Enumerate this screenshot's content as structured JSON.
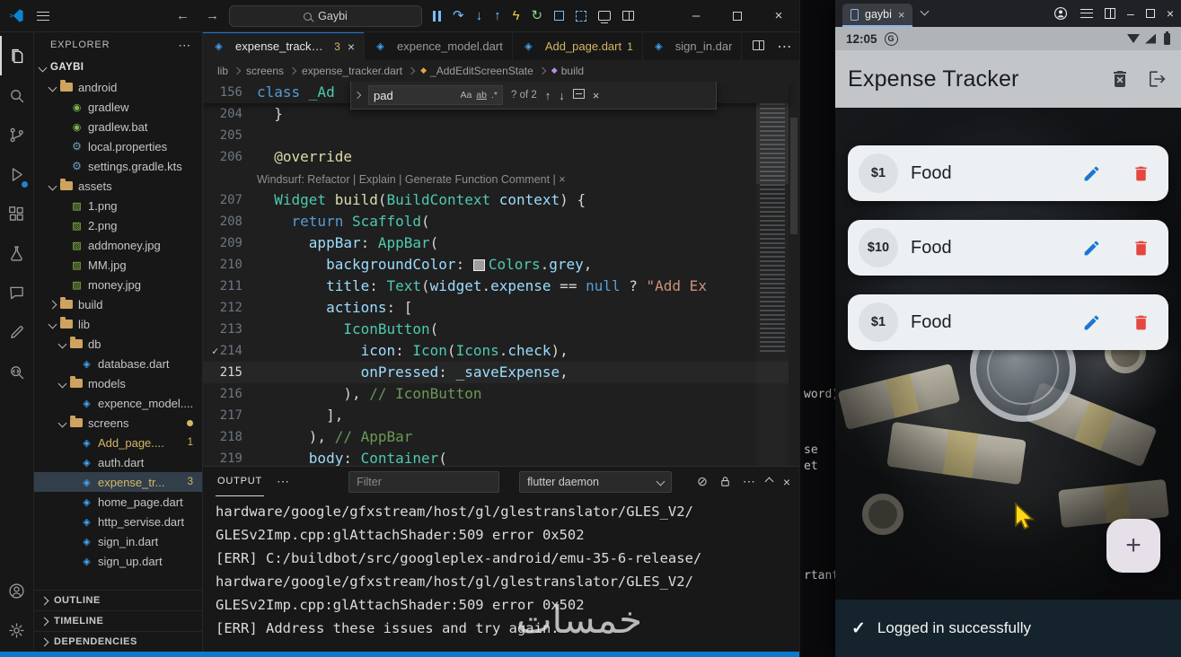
{
  "watermark": "خمسات",
  "fragments": [
    "word)",
    "se",
    "et",
    "rtant"
  ],
  "glyphs": {
    "close": "×",
    "more": "⋯",
    "minimize": "–",
    "check": "✓",
    "plus": "+",
    "back": "←",
    "forward": "→",
    "step_over": "↷",
    "arrow_down": "↓",
    "arrow_up": "↑",
    "bolt": "ϟ",
    "restart": "↻",
    "clear": "⊘",
    "dart": "◈",
    "image": "▨",
    "gradle": "◉",
    "gear": "⚙",
    "sym": "◆"
  },
  "vscode": {
    "titlebar": {
      "search": "Gaybi"
    },
    "activity_bar": [
      "explorer",
      "search",
      "source-control",
      "run-debug",
      "extensions",
      "testing",
      "chat",
      "edit",
      "code-search"
    ],
    "activity_bar_bottom": [
      "account",
      "settings"
    ],
    "explorer": {
      "title": "EXPLORER",
      "sections": [
        "OUTLINE",
        "TIMELINE",
        "DEPENDENCIES"
      ],
      "rows": [
        {
          "label": "GAYBI",
          "type": "root",
          "state": "expanded",
          "depth": 0
        },
        {
          "label": "android",
          "type": "folder",
          "state": "expanded",
          "depth": 1
        },
        {
          "label": "gradlew",
          "type": "file",
          "icon": "gradle",
          "depth": 2
        },
        {
          "label": "gradlew.bat",
          "type": "file",
          "icon": "gradle",
          "depth": 2
        },
        {
          "label": "local.properties",
          "type": "file",
          "icon": "gear",
          "depth": 2
        },
        {
          "label": "settings.gradle.kts",
          "type": "file",
          "icon": "gear",
          "depth": 2
        },
        {
          "label": "assets",
          "type": "folder",
          "state": "expanded",
          "depth": 1
        },
        {
          "label": "1.png",
          "type": "file",
          "icon": "image",
          "depth": 2
        },
        {
          "label": "2.png",
          "type": "file",
          "icon": "image",
          "depth": 2
        },
        {
          "label": "addmoney.jpg",
          "type": "file",
          "icon": "image",
          "depth": 2
        },
        {
          "label": "MM.jpg",
          "type": "file",
          "icon": "image",
          "depth": 2
        },
        {
          "label": "money.jpg",
          "type": "file",
          "icon": "image",
          "depth": 2
        },
        {
          "label": "build",
          "type": "folder",
          "state": "collapsed",
          "depth": 1
        },
        {
          "label": "lib",
          "type": "folder",
          "state": "expanded",
          "depth": 1
        },
        {
          "label": "db",
          "type": "folder",
          "state": "expanded",
          "depth": 2
        },
        {
          "label": "database.dart",
          "type": "file",
          "icon": "dart",
          "depth": 3
        },
        {
          "label": "models",
          "type": "folder",
          "state": "expanded",
          "depth": 2
        },
        {
          "label": "expence_model....",
          "type": "file",
          "icon": "dart",
          "depth": 3
        },
        {
          "label": "screens",
          "type": "folder",
          "state": "expanded",
          "depth": 2,
          "badge": "dot"
        },
        {
          "label": "Add_page....",
          "type": "file",
          "icon": "dart",
          "depth": 3,
          "badge": "1",
          "warn": true
        },
        {
          "label": "auth.dart",
          "type": "file",
          "icon": "dart",
          "depth": 3
        },
        {
          "label": "expense_tr...",
          "type": "file",
          "icon": "dart",
          "depth": 3,
          "badge": "3",
          "warn": true,
          "selected": true
        },
        {
          "label": "home_page.dart",
          "type": "file",
          "icon": "dart",
          "depth": 3
        },
        {
          "label": "http_servise.dart",
          "type": "file",
          "icon": "dart",
          "depth": 3
        },
        {
          "label": "sign_in.dart",
          "type": "file",
          "icon": "dart",
          "depth": 3
        },
        {
          "label": "sign_up.dart",
          "type": "file",
          "icon": "dart",
          "depth": 3
        }
      ]
    },
    "tabs": [
      {
        "label": "expense_tracker.dart",
        "badge": "3",
        "active": true
      },
      {
        "label": "expence_model.dart"
      },
      {
        "label": "Add_page.dart",
        "badge": "1",
        "warn": true
      },
      {
        "label": "sign_in.dar"
      }
    ],
    "breadcrumb": [
      {
        "label": "lib"
      },
      {
        "label": "screens"
      },
      {
        "label": "expense_tracker.dart"
      },
      {
        "label": "_AddEditScreenState",
        "sym": "class"
      },
      {
        "label": "build",
        "sym": "method"
      }
    ],
    "find": {
      "value": "pad",
      "results": "? of 2",
      "toggles": [
        "Aa",
        "ab",
        ".*"
      ]
    },
    "editor": {
      "current_line": "215",
      "check_line": "214",
      "codelens": "Windsurf: Refactor | Explain | Generate Function Comment | ×",
      "lines": [
        {
          "n": "156",
          "sticky": true,
          "t": [
            [
              "kw",
              "class "
            ],
            [
              "type",
              "_Ad"
            ]
          ]
        },
        {
          "n": "204",
          "t": [
            [
              "pun",
              "  }"
            ]
          ]
        },
        {
          "n": "205",
          "t": []
        },
        {
          "n": "206",
          "t": [
            [
              "meta",
              "  @override"
            ]
          ]
        },
        {
          "lens": true
        },
        {
          "n": "207",
          "t": [
            [
              "type",
              "  Widget "
            ],
            [
              "fn",
              "build"
            ],
            [
              "pun",
              "("
            ],
            [
              "type",
              "BuildContext"
            ],
            [
              "var",
              " context"
            ],
            [
              "pun",
              ") {"
            ]
          ]
        },
        {
          "n": "208",
          "t": [
            [
              "pun",
              "    "
            ],
            [
              "kw",
              "return"
            ],
            [
              "type",
              " Scaffold"
            ],
            [
              "pun",
              "("
            ]
          ]
        },
        {
          "n": "209",
          "t": [
            [
              "pun",
              "      "
            ],
            [
              "prop",
              "appBar"
            ],
            [
              "pun",
              ": "
            ],
            [
              "type",
              "AppBar"
            ],
            [
              "pun",
              "("
            ]
          ]
        },
        {
          "n": "210",
          "t": [
            [
              "pun",
              "        "
            ],
            [
              "prop",
              "backgroundColor"
            ],
            [
              "pun",
              ": "
            ],
            [
              "swatch",
              ""
            ],
            [
              "type",
              "Colors"
            ],
            [
              "pun",
              "."
            ],
            [
              "var",
              "grey"
            ],
            [
              "pun",
              ","
            ]
          ]
        },
        {
          "n": "211",
          "t": [
            [
              "pun",
              "        "
            ],
            [
              "prop",
              "title"
            ],
            [
              "pun",
              ": "
            ],
            [
              "type",
              "Text"
            ],
            [
              "pun",
              "("
            ],
            [
              "var",
              "widget"
            ],
            [
              "pun",
              "."
            ],
            [
              "var",
              "expense"
            ],
            [
              "op",
              " == "
            ],
            [
              "kw",
              "null"
            ],
            [
              "op",
              " ? "
            ],
            [
              "str",
              "\"Add Ex"
            ]
          ]
        },
        {
          "n": "212",
          "t": [
            [
              "pun",
              "        "
            ],
            [
              "prop",
              "actions"
            ],
            [
              "pun",
              ": ["
            ]
          ]
        },
        {
          "n": "213",
          "t": [
            [
              "pun",
              "          "
            ],
            [
              "type",
              "IconButton"
            ],
            [
              "pun",
              "("
            ]
          ]
        },
        {
          "n": "214",
          "t": [
            [
              "pun",
              "            "
            ],
            [
              "prop",
              "icon"
            ],
            [
              "pun",
              ": "
            ],
            [
              "type",
              "Icon"
            ],
            [
              "pun",
              "("
            ],
            [
              "type",
              "Icons"
            ],
            [
              "pun",
              "."
            ],
            [
              "var",
              "check"
            ],
            [
              "pun",
              "),"
            ]
          ]
        },
        {
          "n": "215",
          "t": [
            [
              "pun",
              "            "
            ],
            [
              "prop",
              "onPressed"
            ],
            [
              "pun",
              ": "
            ],
            [
              "var",
              "_saveExpense"
            ],
            [
              "pun",
              ","
            ]
          ]
        },
        {
          "n": "216",
          "t": [
            [
              "pun",
              "          ), "
            ],
            [
              "cmt",
              "// IconButton"
            ]
          ]
        },
        {
          "n": "217",
          "t": [
            [
              "pun",
              "        ],"
            ]
          ]
        },
        {
          "n": "218",
          "t": [
            [
              "pun",
              "      ), "
            ],
            [
              "cmt",
              "// AppBar"
            ]
          ]
        },
        {
          "n": "219",
          "t": [
            [
              "pun",
              "      "
            ],
            [
              "prop",
              "body"
            ],
            [
              "pun",
              ": "
            ],
            [
              "type",
              "Container"
            ],
            [
              "pun",
              "("
            ]
          ]
        }
      ]
    },
    "panel": {
      "tab": "OUTPUT",
      "filter_placeholder": "Filter",
      "channel": "flutter daemon",
      "lines": [
        "hardware/google/gfxstream/host/gl/glestranslator/GLES_V2/",
        "GLESv2Imp.cpp:glAttachShader:509 error 0x502",
        "[ERR] C:/buildbot/src/googleplex-android/emu-35-6-release/",
        "hardware/google/gfxstream/host/gl/glestranslator/GLES_V2/",
        "GLESv2Imp.cpp:glAttachShader:509 error 0x502",
        "[ERR] Address these issues and try again."
      ]
    }
  },
  "emulator": {
    "tab": "gaybi",
    "time": "12:05",
    "carrier_badge": "G",
    "app_title": "Expense Tracker",
    "cards": [
      {
        "amount": "$1",
        "label": "Food"
      },
      {
        "amount": "$10",
        "label": "Food"
      },
      {
        "amount": "$1",
        "label": "Food"
      }
    ],
    "fab": "+",
    "snackbar": {
      "icon": "✓",
      "text": "Logged in successfully"
    }
  }
}
